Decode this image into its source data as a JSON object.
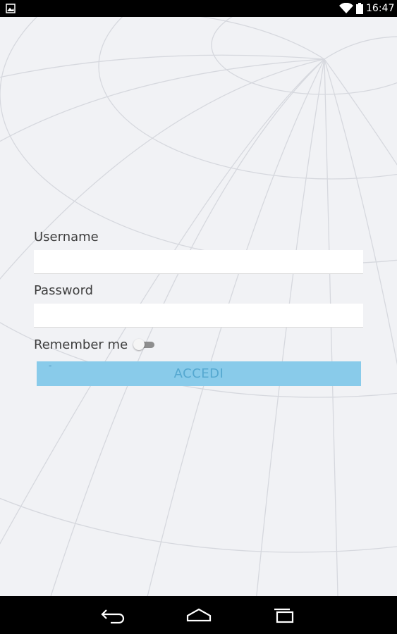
{
  "status_bar": {
    "time": "16:47"
  },
  "login_form": {
    "username_label": "Username",
    "username_value": "",
    "password_label": "Password",
    "password_value": "",
    "remember_label": "Remember me",
    "remember_checked": false,
    "submit_label": "ACCEDI"
  },
  "colors": {
    "background": "#f1f2f5",
    "button": "#89cbea",
    "button_text": "#55a8d0"
  },
  "icons": [
    "image-notification-icon",
    "wifi-icon",
    "battery-icon",
    "back-icon",
    "home-icon",
    "recent-apps-icon"
  ]
}
